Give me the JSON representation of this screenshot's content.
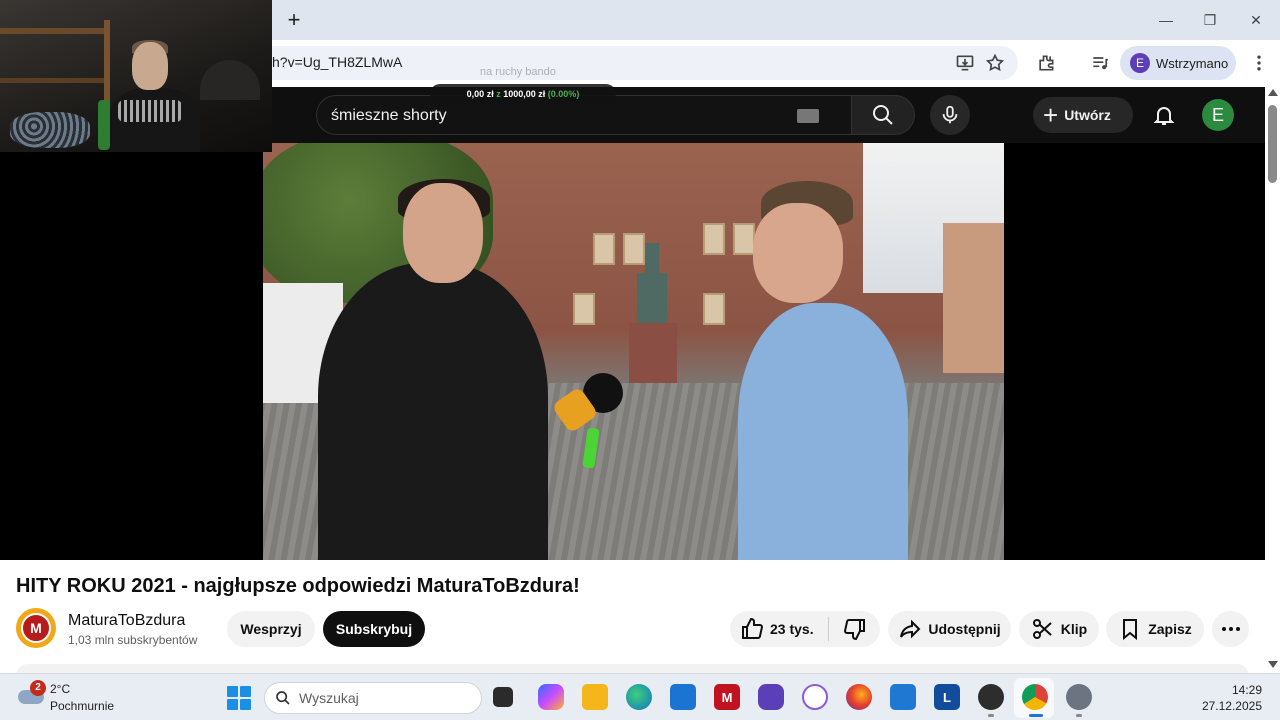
{
  "browser": {
    "url_fragment": "h?v=Ug_TH8ZLMwA",
    "profile_initial": "E",
    "profile_label": "Wstrzymano",
    "overlay_ghost_text": "na ruchy bando"
  },
  "balance_widget": {
    "prefix": "0,00 zł",
    "z": "z",
    "total": "1000,00 zł",
    "percent": "(0.00%)"
  },
  "youtube_header": {
    "search_query": "śmieszne shorty",
    "create_label": "Utwórz",
    "avatar_initial": "E"
  },
  "video": {
    "title": "HITY ROKU 2021 - najgłupsze odpowiedzi MaturaToBzdura!",
    "channel_name": "MaturaToBzdura",
    "channel_logo_letter": "M",
    "subscribers": "1,03 mln subskrybentów",
    "support_label": "Wesprzyj",
    "subscribe_label": "Subskrybuj",
    "likes": "23 tys.",
    "share_label": "Udostępnij",
    "clip_label": "Klip",
    "save_label": "Zapisz"
  },
  "taskbar": {
    "weather_badge": "2",
    "temperature": "2°C",
    "condition": "Pochmurnie",
    "search_label": "Wyszukaj",
    "time": "14:29",
    "date": "27.12.2025",
    "apps": [
      "file-explorer-gray",
      "copilot",
      "file-explorer",
      "edge",
      "store",
      "mcafee",
      "proton-vpn",
      "app-flower",
      "firefox",
      "mail",
      "l-app",
      "obs",
      "chrome",
      "settings"
    ]
  },
  "colors": {
    "youtube_dark": "#0f0f0f",
    "chrome_tabstrip": "#dfe5ee",
    "accent_green": "#4caf50",
    "subscribe_bg": "#0f0f0f"
  }
}
